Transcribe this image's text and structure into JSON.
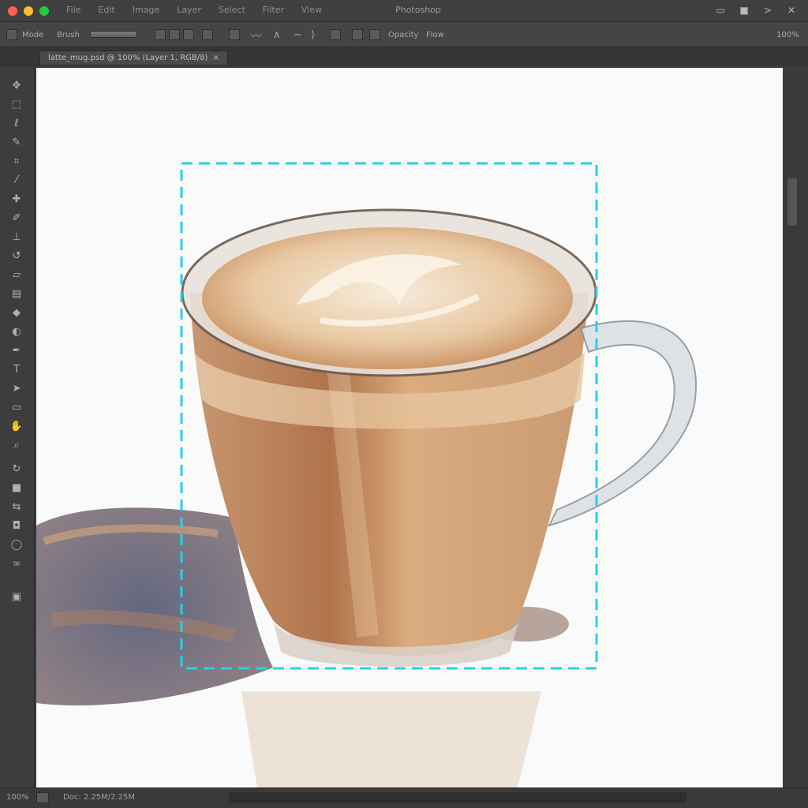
{
  "window": {
    "title": "Photoshop",
    "menu": [
      "File",
      "Edit",
      "Image",
      "Layer",
      "Select",
      "Filter",
      "View"
    ],
    "traffic_colors": [
      "#ff5f57",
      "#febc2e",
      "#28c840"
    ]
  },
  "options_bar": {
    "mode_label": "Mode",
    "opacity_label": "Opacity",
    "flow_label": "Flow",
    "brush_label": "Brush",
    "right_label": "100%"
  },
  "document_tab": {
    "label": "latte_mug.psd @ 100% (Layer 1, RGB/8)",
    "close": "×"
  },
  "tools": [
    "move-tool",
    "marquee-tool",
    "lasso-tool",
    "quick-select-tool",
    "crop-tool",
    "eyedropper-tool",
    "healing-tool",
    "brush-tool",
    "stamp-tool",
    "history-brush-tool",
    "eraser-tool",
    "gradient-tool",
    "blur-tool",
    "dodge-tool",
    "pen-tool",
    "type-tool",
    "path-select-tool",
    "shape-tool",
    "hand-tool",
    "zoom-tool",
    "foreground-color",
    "quick-mask"
  ],
  "selection": {
    "color": "#22d3e6"
  },
  "status_bar": {
    "zoom": "100%",
    "doc_info": "Doc: 2.25M/2.25M"
  }
}
